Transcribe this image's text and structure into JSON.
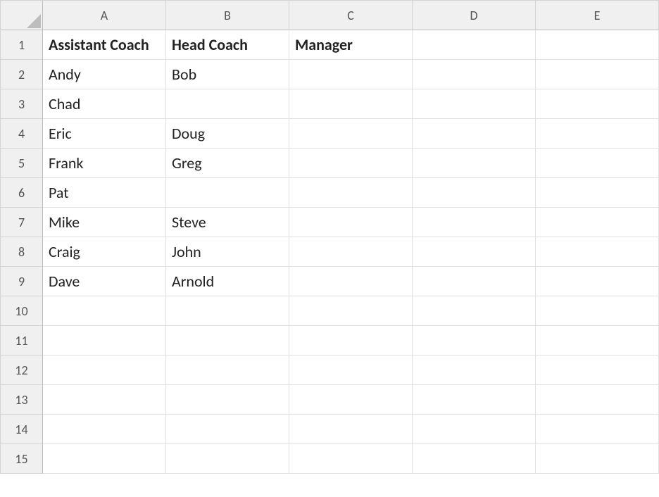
{
  "sheet": {
    "columns": [
      "A",
      "B",
      "C",
      "D",
      "E"
    ],
    "rowCount": 15,
    "headers": {
      "A1": "Assistant Coach",
      "B1": "Head Coach",
      "C1": "Manager"
    },
    "data": {
      "A2": "Andy",
      "B2": "Bob",
      "A3": "Chad",
      "A4": "Eric",
      "B4": "Doug",
      "A5": "Frank",
      "B5": "Greg",
      "A6": "Pat",
      "A7": "Mike",
      "B7": "Steve",
      "A8": "Craig",
      "B8": "John",
      "A9": "Dave",
      "B9": "Arnold"
    }
  }
}
